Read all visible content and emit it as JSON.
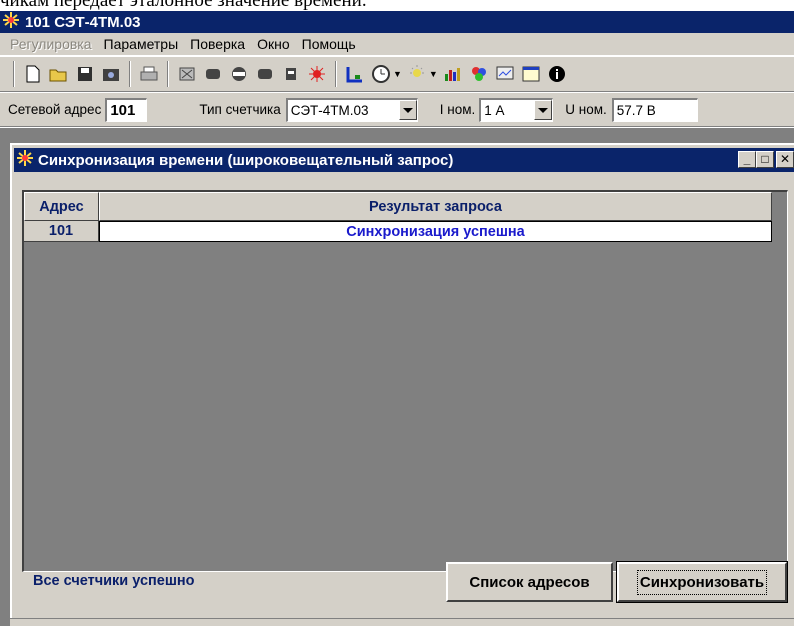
{
  "document_text": "чикам передает эталонное значение времени.",
  "app": {
    "title": "101  СЭТ-4ТМ.03"
  },
  "menu": [
    {
      "label": "Регулировка",
      "disabled": true
    },
    {
      "label": "Параметры",
      "disabled": false
    },
    {
      "label": "Поверка",
      "disabled": false
    },
    {
      "label": "Окно",
      "disabled": false
    },
    {
      "label": "Помощь",
      "disabled": false
    }
  ],
  "toolbar": {
    "icons": [
      "new-icon",
      "open-icon",
      "save-icon",
      "camera-icon",
      "print-icon",
      "meter-icon",
      "connect-icon",
      "stop-icon",
      "disconnect-icon",
      "device-icon",
      "bug-icon",
      "graph-icon",
      "clock-icon",
      "light-icon",
      "chart-icon",
      "palette-icon",
      "monitor-icon",
      "window-icon",
      "info-icon"
    ]
  },
  "addressbar": {
    "address_label": "Сетевой адрес",
    "address_value": "101",
    "meter_type_label": "Тип счетчика",
    "meter_type_value": "СЭТ-4ТМ.03",
    "inom_label": "I ном.",
    "inom_value": "1 А",
    "unom_label": "U ном.",
    "unom_value": "57.7 В"
  },
  "dialog": {
    "title": "Синхронизация времени (широковещательный запрос)",
    "table": {
      "headers": [
        "Адрес",
        "Результат запроса"
      ],
      "rows": [
        {
          "address": "101",
          "result": "Синхронизация успешна"
        }
      ]
    },
    "status": "Все счетчики успешно",
    "list_button": "Список адресов",
    "sync_button": "Синхронизовать"
  },
  "colors": {
    "title_bar": "#0a246a",
    "result_text": "#1a1acc",
    "face": "#d4d0c8"
  }
}
